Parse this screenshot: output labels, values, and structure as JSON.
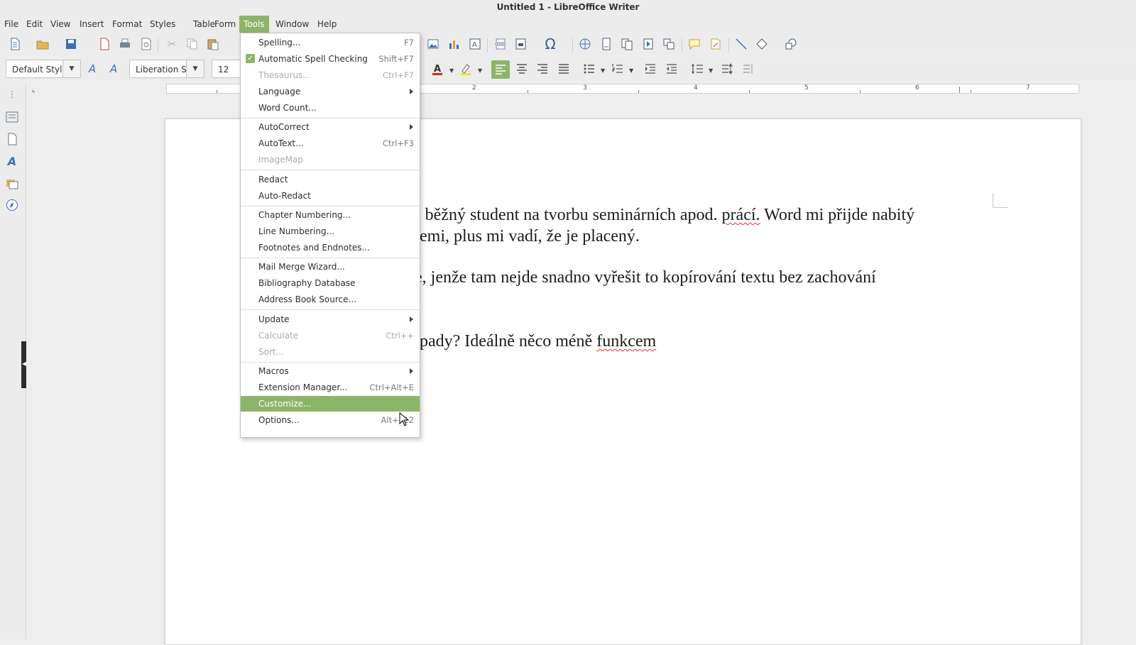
{
  "window": {
    "title": "Untitled 1 - LibreOffice Writer"
  },
  "menubar": [
    "File",
    "Edit",
    "View",
    "Insert",
    "Format",
    "Styles",
    "Table",
    "Form",
    "Tools",
    "Window",
    "Help"
  ],
  "active_menu": "Tools",
  "formatting": {
    "paragraph_style": "Default Styl",
    "font_name": "Liberation S",
    "font_size": "12"
  },
  "ruler_numbers": [
    "2",
    "3",
    "4",
    "5",
    "6",
    "7"
  ],
  "document": {
    "lines": [
      "e běžný student na tvorbu seminárních apod.",
      "prácí.",
      "Word mi přijde nabitý",
      "emi, plus mi vadí, že je placený.",
      "e, jenže tam nejde snadno vyřešit to kopírování textu bez zachování",
      "pady? Ideálně něco méně",
      "funkcem"
    ]
  },
  "tools_menu": [
    {
      "label": "Spelling...",
      "shortcut": "F7"
    },
    {
      "label": "Automatic Spell Checking",
      "shortcut": "Shift+F7",
      "checked": true
    },
    {
      "label": "Thesaurus...",
      "shortcut": "Ctrl+F7",
      "disabled": true
    },
    {
      "label": "Language",
      "submenu": true
    },
    {
      "label": "Word Count..."
    },
    {
      "label": "AutoCorrect",
      "submenu": true
    },
    {
      "label": "AutoText...",
      "shortcut": "Ctrl+F3"
    },
    {
      "label": "ImageMap",
      "disabled": true
    },
    {
      "label": "Redact"
    },
    {
      "label": "Auto-Redact"
    },
    {
      "label": "Chapter Numbering..."
    },
    {
      "label": "Line Numbering..."
    },
    {
      "label": "Footnotes and Endnotes..."
    },
    {
      "label": "Mail Merge Wizard..."
    },
    {
      "label": "Bibliography Database"
    },
    {
      "label": "Address Book Source..."
    },
    {
      "label": "Update",
      "submenu": true
    },
    {
      "label": "Calculate",
      "shortcut": "Ctrl++",
      "disabled": true
    },
    {
      "label": "Sort...",
      "disabled": true
    },
    {
      "label": "Macros",
      "submenu": true
    },
    {
      "label": "Extension Manager...",
      "shortcut": "Ctrl+Alt+E"
    },
    {
      "label": "Customize...",
      "highlighted": true
    },
    {
      "label": "Options...",
      "shortcut": "Alt+F12"
    }
  ],
  "colors": {
    "accent": "#8db56a",
    "menu_bg": "#ececec",
    "spell_error": "#e03030"
  },
  "icons": {
    "toolbar1": [
      "new-document-icon",
      "open-icon",
      "save-icon",
      "export-pdf-icon",
      "print-icon",
      "print-preview-icon",
      "cut-icon",
      "copy-icon",
      "paste-icon",
      "insert-image-icon",
      "insert-chart-icon",
      "insert-textbox-icon",
      "page-break-icon",
      "insert-field-icon",
      "special-character-icon",
      "hyperlink-icon",
      "footnote-icon",
      "endnote-icon",
      "bookmark-icon",
      "cross-reference-icon",
      "comment-icon",
      "track-changes-icon",
      "line-icon",
      "basic-shapes-icon",
      "draw-functions-icon"
    ],
    "toolbar2": [
      "update-style-icon",
      "new-style-icon",
      "font-color-icon",
      "highlight-icon",
      "align-left-icon",
      "align-center-icon",
      "align-right-icon",
      "justify-icon",
      "bullet-list-icon",
      "numbered-list-icon",
      "increase-indent-icon",
      "decrease-indent-icon",
      "line-spacing-icon",
      "paragraph-spacing-increase-icon",
      "paragraph-spacing-decrease-icon"
    ],
    "sidebar": [
      "properties-icon",
      "page-icon",
      "styles-icon",
      "gallery-icon",
      "navigator-icon"
    ]
  }
}
